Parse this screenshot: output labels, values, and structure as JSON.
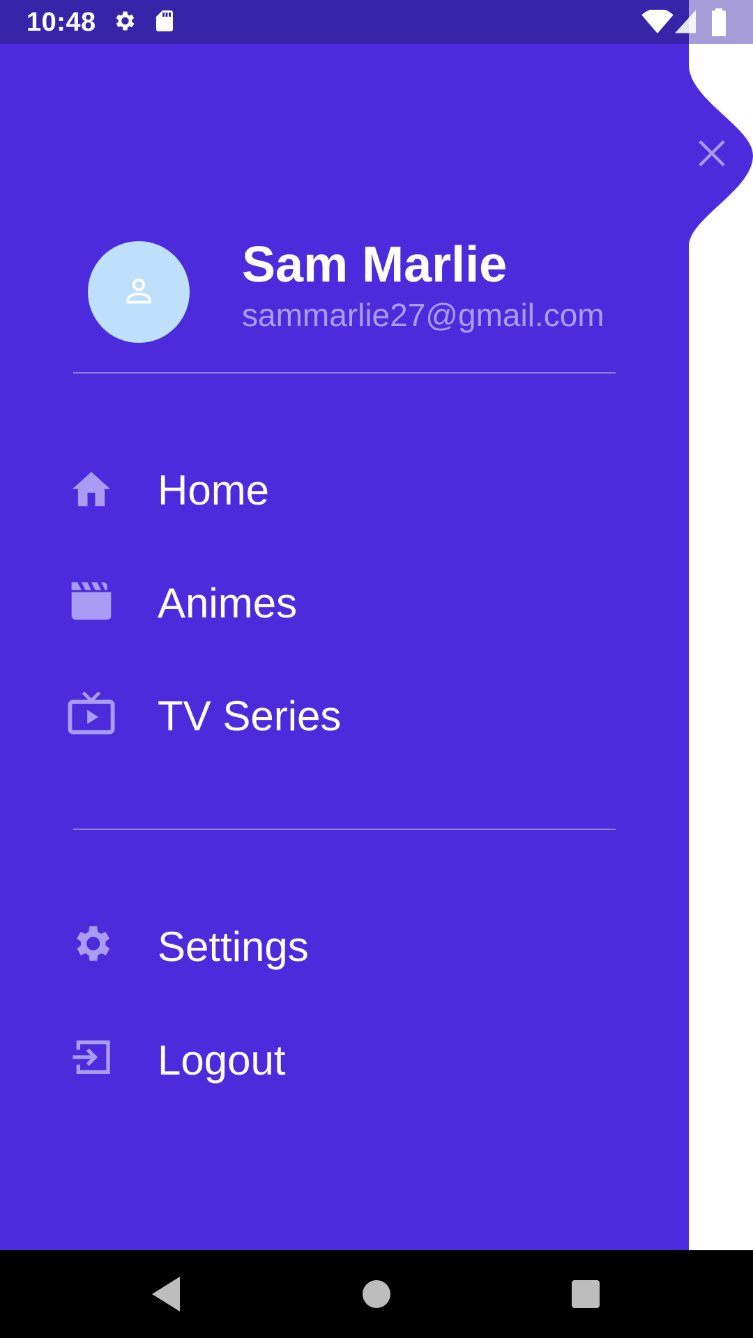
{
  "status_bar": {
    "time": "10:48",
    "left_icons": [
      "gear-icon",
      "sd-card-icon"
    ],
    "right_icons": [
      "wifi-icon",
      "signal-icon",
      "battery-icon"
    ],
    "background": "#3824a8"
  },
  "drawer": {
    "background": "#4c2bdc",
    "accent_icon_color": "#a99cf2",
    "profile": {
      "name": "Sam Marlie",
      "email": "sammarlie27@gmail.com",
      "avatar_icon": "person-icon",
      "avatar_background": "#bfe0fb"
    },
    "primary_items": [
      {
        "label": "Home",
        "icon": "home-icon"
      },
      {
        "label": "Animes",
        "icon": "movie-clapper-icon"
      },
      {
        "label": "TV Series",
        "icon": "tv-icon"
      }
    ],
    "secondary_items": [
      {
        "label": "Settings",
        "icon": "gear-icon"
      },
      {
        "label": "Logout",
        "icon": "logout-icon"
      }
    ],
    "close_icon": "close-icon"
  },
  "nav_bar": {
    "buttons": [
      "back-icon",
      "home-circle-icon",
      "recents-icon"
    ]
  }
}
